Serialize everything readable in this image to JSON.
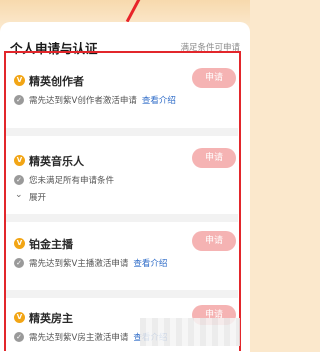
{
  "section": {
    "title": "个人申请与认证",
    "hint": "满足条件可申请"
  },
  "items": [
    {
      "title": "精英创作者",
      "button": "申请",
      "desc": "需先达到紫V创作者激活申请",
      "link": "查看介绍"
    },
    {
      "title": "精英音乐人",
      "button": "申请",
      "desc": "您未满足所有申请条件",
      "expand": "展开"
    },
    {
      "title": "铂金主播",
      "button": "申请",
      "desc": "需先达到紫V主播激活申请",
      "link": "查看介绍"
    },
    {
      "title": "精英房主",
      "button": "申请",
      "desc": "需先达到紫V房主激活申请",
      "link": "查看介绍"
    }
  ],
  "colors": {
    "accent_badge": "#f2a515",
    "apply_button": "#f5b3b3",
    "link": "#2f6cc8",
    "highlight": "#e2262b"
  }
}
